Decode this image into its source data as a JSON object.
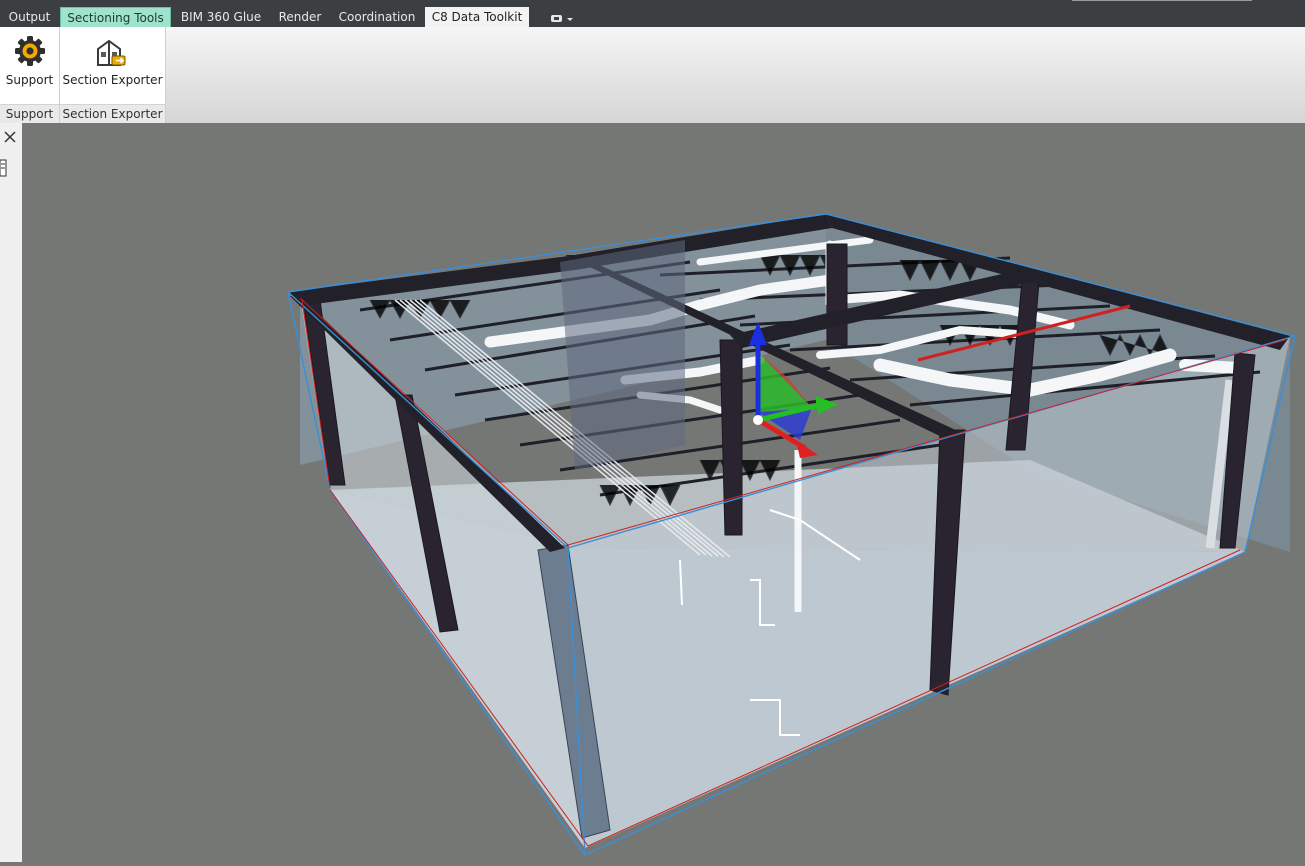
{
  "tabs": [
    {
      "label": "Output"
    },
    {
      "label": "Sectioning Tools"
    },
    {
      "label": "BIM 360 Glue"
    },
    {
      "label": "Render"
    },
    {
      "label": "Coordination"
    },
    {
      "label": "C8 Data Toolkit"
    }
  ],
  "ribbon": {
    "support": {
      "button_label": "Support",
      "panel_title": "Support"
    },
    "exporter": {
      "button_label": "Section Exporter",
      "panel_title": "Section Exporter"
    }
  },
  "icons": {
    "support": "gear-icon",
    "exporter": "section-export-icon",
    "close": "close-icon",
    "quick_access": "dropdown-icon"
  },
  "colors": {
    "active_tab": "#9fe3cc",
    "tab_bar": "#3c3f41",
    "viewport_bg": "#757775",
    "section_box": "#3a8fd8",
    "gizmo_x": "#e02020",
    "gizmo_y": "#22c022",
    "gizmo_z": "#1a2fe0"
  }
}
